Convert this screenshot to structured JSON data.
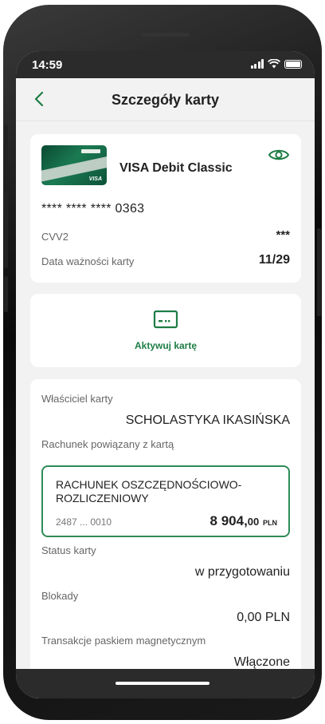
{
  "status_bar": {
    "time": "14:59"
  },
  "header": {
    "title": "Szczegóły karty"
  },
  "card": {
    "name": "VISA Debit Classic",
    "image_logo_text": "VISA",
    "number": "**** **** **** 0363",
    "cvv_label": "CVV2",
    "cvv_value": "***",
    "expiry_label": "Data ważności karty",
    "expiry_value": "11/29"
  },
  "activate": {
    "label": "Aktywuj kartę"
  },
  "details": {
    "owner_label": "Właściciel karty",
    "owner_value": "SCHOLASTYKA IKASIŃSKA",
    "account_label": "Rachunek powiązany z kartą",
    "account": {
      "name": "RACHUNEK OSZCZĘDNOŚCIOWO-ROZLICZENIOWY",
      "number": "2487 ... 0010",
      "balance_int": "8 904,",
      "balance_dec": "00",
      "currency": "PLN"
    },
    "status_label": "Status karty",
    "status_value": "w przygotowaniu",
    "blocks_label": "Blokady",
    "blocks_value": "0,00 PLN",
    "magstripe_label": "Transakcje paskiem magnetycznym",
    "magstripe_value": "Włączone"
  },
  "colors": {
    "accent": "#1e7d45",
    "border": "#2e8b57",
    "status_bar": "#2b2b2b"
  }
}
